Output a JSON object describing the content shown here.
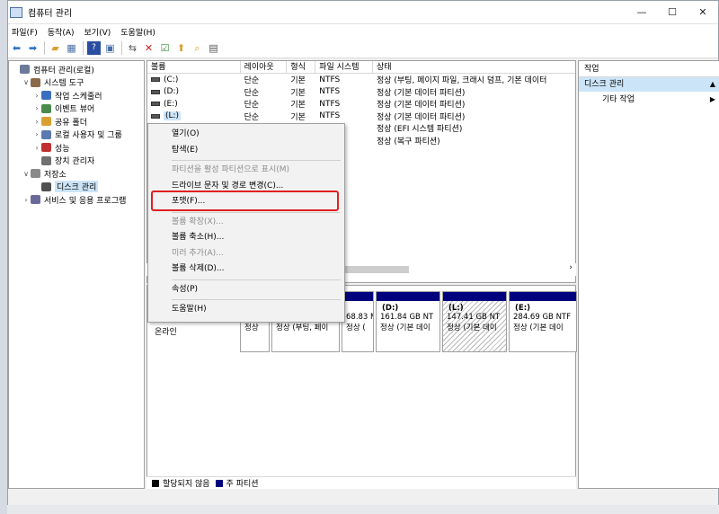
{
  "window": {
    "title": "컴퓨터 관리",
    "controls": {
      "minimize": "—",
      "maximize": "☐",
      "close": "✕"
    }
  },
  "menubar": [
    "파일(F)",
    "동작(A)",
    "보기(V)",
    "도움말(H)"
  ],
  "tree": [
    {
      "label": "컴퓨터 관리(로컬)",
      "chev": "",
      "icon": "#6a7a9a",
      "indent": 0
    },
    {
      "label": "시스템 도구",
      "chev": "∨",
      "icon": "#8a6a4a",
      "indent": 1
    },
    {
      "label": "작업 스케줄러",
      "chev": "›",
      "icon": "#3a6fbf",
      "indent": 2
    },
    {
      "label": "이벤트 뷰어",
      "chev": "›",
      "icon": "#4a8a4a",
      "indent": 2
    },
    {
      "label": "공유 폴더",
      "chev": "›",
      "icon": "#d8a030",
      "indent": 2
    },
    {
      "label": "로컬 사용자 및 그룹",
      "chev": "›",
      "icon": "#5a7ab0",
      "indent": 2
    },
    {
      "label": "성능",
      "chev": "›",
      "icon": "#c03030",
      "indent": 2
    },
    {
      "label": "장치 관리자",
      "chev": "",
      "icon": "#707070",
      "indent": 2
    },
    {
      "label": "저장소",
      "chev": "∨",
      "icon": "#8a8a8a",
      "indent": 1
    },
    {
      "label": "디스크 관리",
      "chev": "",
      "icon": "#505050",
      "indent": 2,
      "selected": true
    },
    {
      "label": "서비스 및 응용 프로그램",
      "chev": "›",
      "icon": "#6a6a9a",
      "indent": 1
    }
  ],
  "list": {
    "headers": [
      "볼륨",
      "레이아웃",
      "형식",
      "파일 시스템",
      "상태"
    ],
    "rows": [
      {
        "volume": "(C:)",
        "layout": "단순",
        "type": "기본",
        "fs": "NTFS",
        "status": "정상 (부팅, 페이지 파일, 크래시 덤프, 기본 데이터"
      },
      {
        "volume": "(D:)",
        "layout": "단순",
        "type": "기본",
        "fs": "NTFS",
        "status": "정상 (기본 데이터 파티션)"
      },
      {
        "volume": "(E:)",
        "layout": "단순",
        "type": "기본",
        "fs": "NTFS",
        "status": "정상 (기본 데이터 파티션)"
      },
      {
        "volume": "(L:)",
        "layout": "단순",
        "type": "기본",
        "fs": "NTFS",
        "status": "정상 (기본 데이터 파티션)"
      },
      {
        "volume": "",
        "layout": "",
        "type": "",
        "fs": "",
        "status": "정상 (EFI 시스템 파티션)"
      },
      {
        "volume": "",
        "layout": "",
        "type": "",
        "fs": "",
        "status": "정상 (복구 파티션)"
      }
    ]
  },
  "disk": {
    "label": "온라인",
    "partitions": [
      {
        "name": "",
        "size": "",
        "status": "정상"
      },
      {
        "name": "",
        "size": "",
        "status": "정상 (부팅, 페이"
      },
      {
        "name": "",
        "size": "68.83 M",
        "status": "정상 ("
      },
      {
        "name": "(D:)",
        "size": "161.84 GB NT",
        "status": "정상 (기본 데이"
      },
      {
        "name": "(L:)",
        "size": "147.41 GB NT",
        "status": "정상 (기본 데이"
      },
      {
        "name": "(E:)",
        "size": "284.69 GB NTF",
        "status": "정상 (기본 데이"
      }
    ]
  },
  "legend": [
    {
      "label": "할당되지 않음",
      "color": "#000000"
    },
    {
      "label": "주 파티션",
      "color": "#00007f"
    }
  ],
  "actions": {
    "header": "작업",
    "section": "디스크 관리",
    "items": [
      {
        "label": "기타 작업"
      }
    ]
  },
  "context_menu": {
    "items": [
      {
        "label": "열기(O)",
        "disabled": false
      },
      {
        "label": "탐색(E)",
        "disabled": false
      },
      {
        "sep": true
      },
      {
        "label": "파티션을 활성 파티션으로 표시(M)",
        "disabled": true
      },
      {
        "label": "드라이브 문자 및 경로 변경(C)...",
        "disabled": false
      },
      {
        "label": "포맷(F)...",
        "disabled": false
      },
      {
        "sep": true
      },
      {
        "label": "볼륨 확장(X)...",
        "disabled": true
      },
      {
        "label": "볼륨 축소(H)...",
        "disabled": false
      },
      {
        "label": "미러 추가(A)...",
        "disabled": true
      },
      {
        "label": "볼륨 삭제(D)...",
        "disabled": false
      },
      {
        "sep": true
      },
      {
        "label": "속성(P)",
        "disabled": false
      },
      {
        "sep": true
      },
      {
        "label": "도움말(H)",
        "disabled": false
      }
    ]
  },
  "colors": {
    "accent_highlight": "#e02020",
    "selection": "#cce4f7",
    "partition_bar": "#00007f"
  }
}
